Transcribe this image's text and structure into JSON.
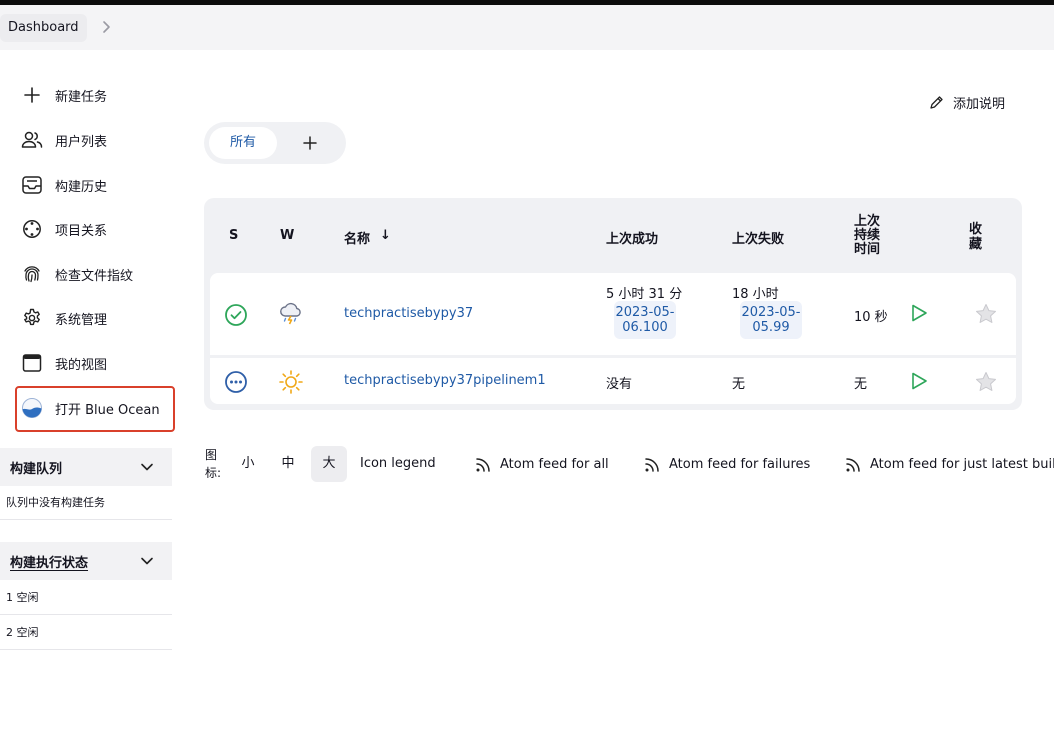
{
  "breadcrumb": {
    "root": "Dashboard"
  },
  "sidebar": {
    "tasks": [
      {
        "label": "新建任务",
        "icon": "plus-icon"
      },
      {
        "label": "用户列表",
        "icon": "users-icon"
      },
      {
        "label": "构建历史",
        "icon": "inbox-icon"
      },
      {
        "label": "项目关系",
        "icon": "relationship-icon"
      },
      {
        "label": "检查文件指纹",
        "icon": "fingerprint-icon"
      },
      {
        "label": "系统管理",
        "icon": "gear-icon"
      },
      {
        "label": "我的视图",
        "icon": "window-icon"
      },
      {
        "label": "打开 Blue Ocean",
        "icon": "blue-ocean-icon"
      }
    ],
    "build_queue": {
      "title": "构建队列",
      "empty": "队列中没有构建任务"
    },
    "executors": {
      "title": "构建执行状态",
      "rows": [
        "1  空闲",
        "2  空闲"
      ]
    }
  },
  "main": {
    "add_description": "添加说明",
    "tabs": {
      "active": "所有"
    },
    "table": {
      "headers": {
        "s": "S",
        "w": "W",
        "name": "名称",
        "sort_arrow": "↓",
        "last_success": "上次成功",
        "last_failure": "上次失败",
        "duration": "上次持续时间",
        "fav": "收藏"
      },
      "rows": [
        {
          "status": "success",
          "weather": "storm",
          "name": "techpractisebypy37",
          "last_success": "5 小时 31 分",
          "last_success_date": "2023-05-06.100",
          "last_failure": "18 小时",
          "last_failure_date": "2023-05-05.99",
          "duration": "10 秒"
        },
        {
          "status": "not-built",
          "weather": "sunny",
          "name": "techpractisebypy37pipelinem1",
          "last_success": "没有",
          "last_failure": "无",
          "duration": "无"
        }
      ]
    },
    "footer": {
      "icon_label": "图标:",
      "sizes": [
        "小",
        "中",
        "大"
      ],
      "active_size": "大",
      "icon_legend": "Icon legend",
      "feeds": [
        "Atom feed for all",
        "Atom feed for failures",
        "Atom feed for just latest builds"
      ]
    }
  }
}
